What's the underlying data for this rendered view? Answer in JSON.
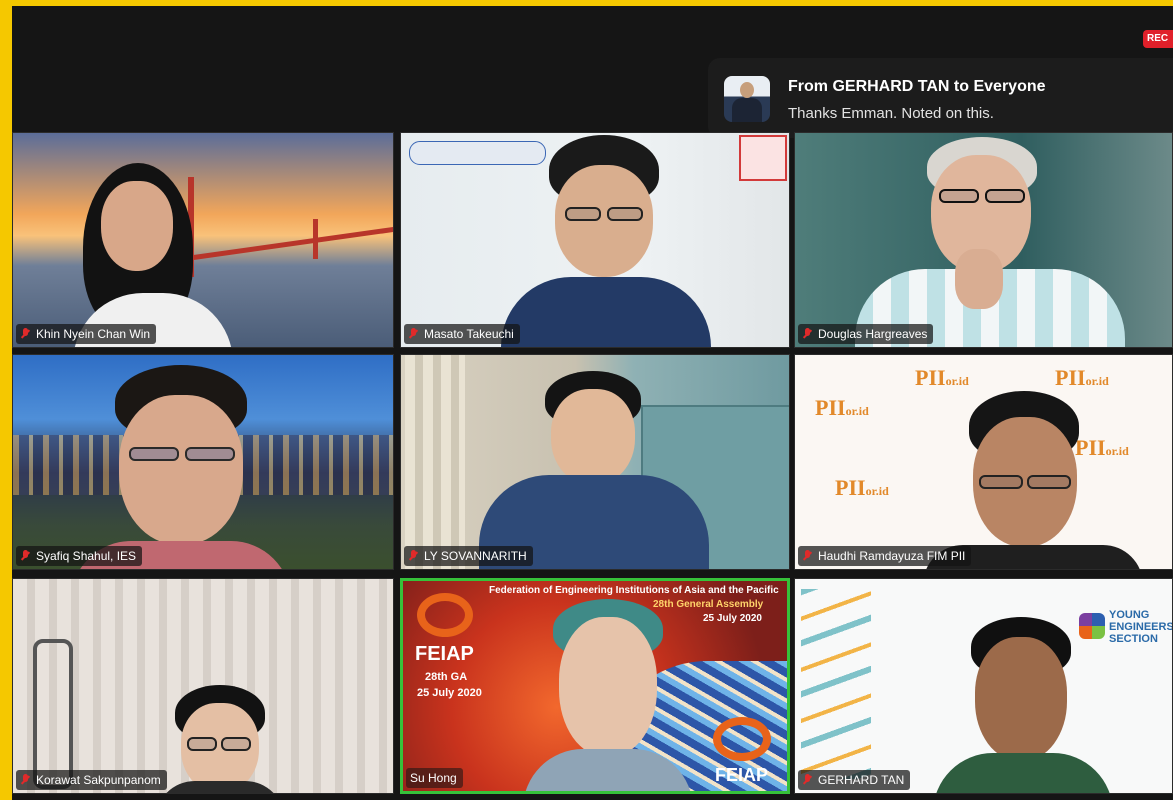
{
  "app": {
    "rec_label": "REC"
  },
  "chat": {
    "from": "From GERHARD TAN to Everyone",
    "message": "Thanks Emman. Noted on this.",
    "avatar_icon": "avatar-photo"
  },
  "participants": [
    {
      "name": "Khin Nyein Chan Win",
      "muted": true
    },
    {
      "name": "Masato Takeuchi",
      "muted": true
    },
    {
      "name": "Douglas Hargreaves",
      "muted": true
    },
    {
      "name": "Syafiq Shahul, IES",
      "muted": true
    },
    {
      "name": "LY SOVANNARITH",
      "muted": true
    },
    {
      "name": "Haudhi Ramdayuza FIM PII",
      "muted": true
    },
    {
      "name": "Korawat Sakpunpanom",
      "muted": true
    },
    {
      "name": "Su Hong",
      "muted": false
    },
    {
      "name": "GERHARD TAN",
      "muted": true
    }
  ],
  "backgrounds": {
    "feiap_banner": "Federation of Engineering Institutions of Asia and the Pacific",
    "feiap_assembly": "28th General Assembly",
    "feiap_date": "25 July 2020",
    "feiap_logo": "FEIAP",
    "feiap_side_ga": "28th GA",
    "feiap_side_date": "25 July 2020",
    "pii_logo": "PII",
    "pii_domain": "or.id",
    "yes_label_1": "YOUNG",
    "yes_label_2": "ENGINEERS",
    "yes_label_3": "SECTION"
  },
  "colors": {
    "frame": "#f5c800",
    "app_bg": "#151515",
    "rec": "#e0202a",
    "mute": "#e02a2a",
    "feiap_orange": "#e8631a"
  }
}
